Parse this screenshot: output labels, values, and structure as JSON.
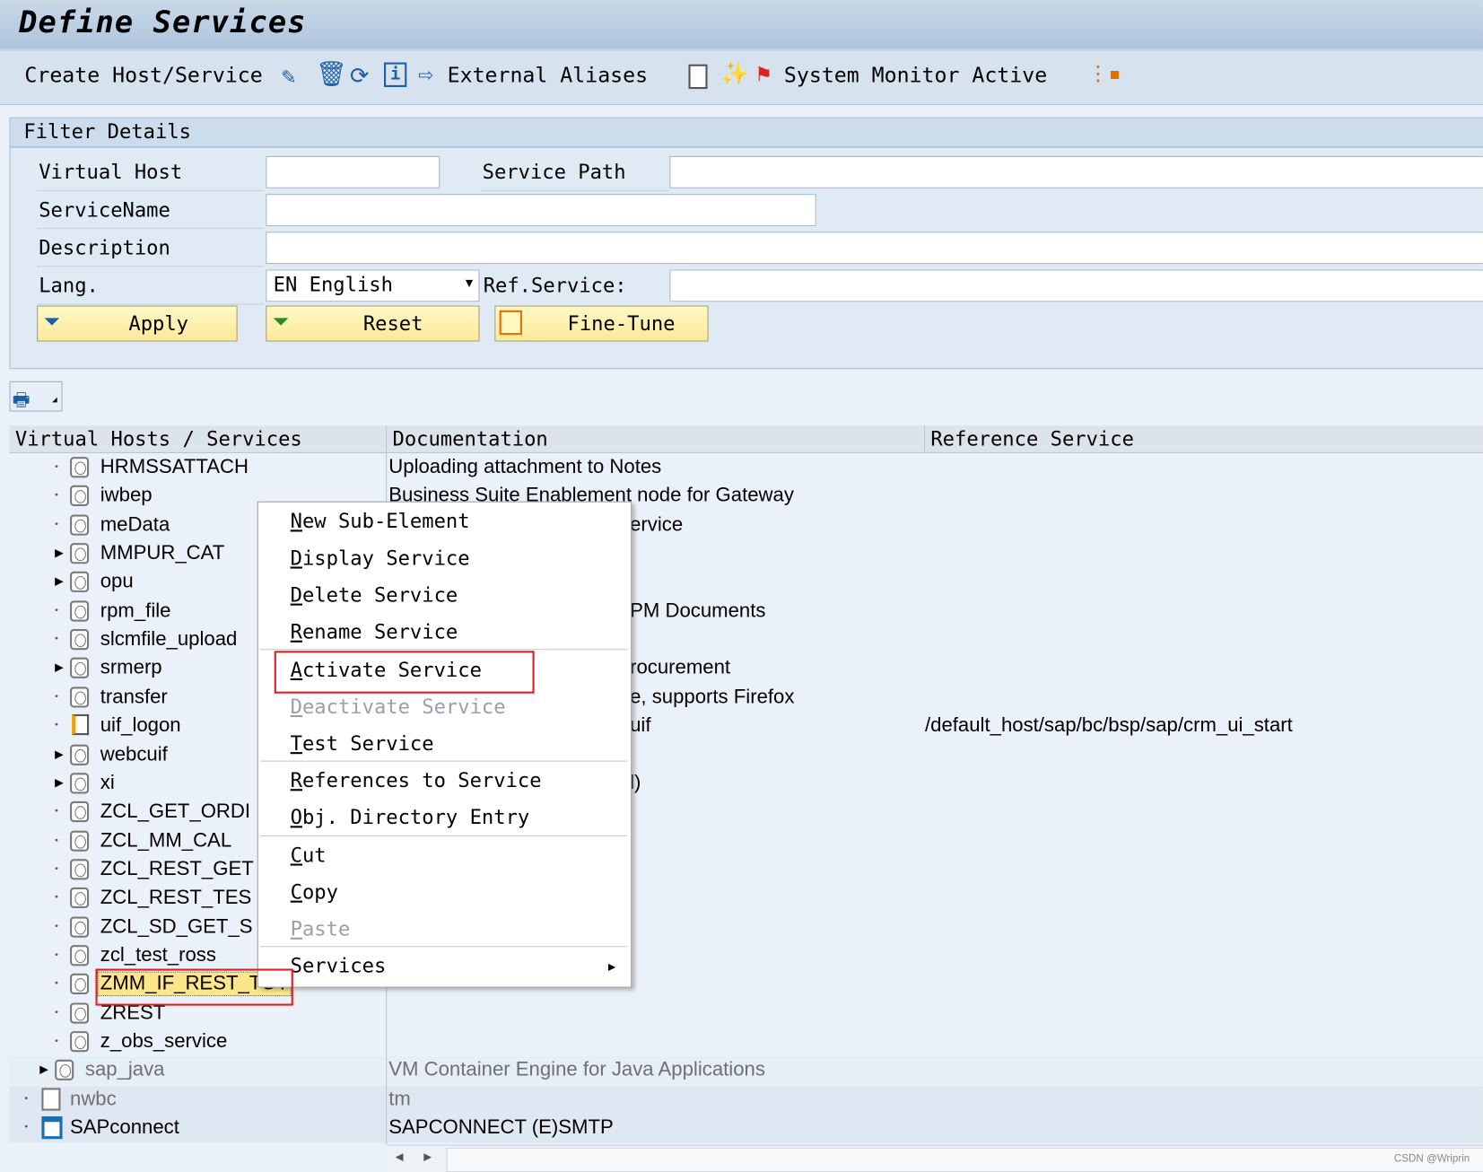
{
  "title": "Define Services",
  "toolbar": {
    "create": "Create Host/Service",
    "external_aliases": "External Aliases",
    "system_monitor": "System Monitor Active"
  },
  "filter": {
    "header": "Filter Details",
    "virtual_host_label": "Virtual Host",
    "virtual_host_value": "",
    "service_path_label": "Service Path",
    "service_path_value": "",
    "service_name_label": "ServiceName",
    "service_name_value": "",
    "description_label": "Description",
    "description_value": "",
    "lang_label": "Lang.",
    "lang_value": "EN English",
    "ref_service_label": "Ref.Service:",
    "ref_service_value": "",
    "apply": "Apply",
    "reset": "Reset",
    "fine_tune": "Fine-Tune"
  },
  "table": {
    "headers": [
      "Virtual Hosts / Services",
      "Documentation",
      "Reference Service"
    ],
    "rows": [
      {
        "name": "HRMSSATTACH",
        "exp": "dot",
        "level": 2,
        "doc": "Uploading attachment to Notes",
        "doc_at": "start",
        "ref": ""
      },
      {
        "name": "iwbep",
        "exp": "dot",
        "level": 2,
        "doc": "Business Suite Enablement node for Gateway",
        "doc_at": "start",
        "ref": ""
      },
      {
        "name": "meData",
        "exp": "dot",
        "level": 2,
        "doc": "ervice",
        "doc_at": "menu",
        "ref": ""
      },
      {
        "name": "MMPUR_CAT",
        "exp": "tri",
        "level": 2,
        "doc": "",
        "doc_at": "start",
        "ref": ""
      },
      {
        "name": "opu",
        "exp": "tri",
        "level": 2,
        "doc": "",
        "doc_at": "start",
        "ref": ""
      },
      {
        "name": "rpm_file",
        "exp": "dot",
        "level": 2,
        "doc": "PM Documents",
        "doc_at": "menu",
        "ref": ""
      },
      {
        "name": "slcmfile_upload",
        "exp": "dot",
        "level": 2,
        "doc": "",
        "doc_at": "start",
        "ref": ""
      },
      {
        "name": "srmerp",
        "exp": "tri",
        "level": 2,
        "doc": "rocurement",
        "doc_at": "menu",
        "ref": ""
      },
      {
        "name": "transfer",
        "exp": "dot",
        "level": 2,
        "doc": "e, supports Firefox",
        "doc_at": "menu",
        "ref": ""
      },
      {
        "name": "uif_logon",
        "exp": "dot",
        "level": 2,
        "icon": "alias",
        "doc": "uif",
        "doc_at": "menu",
        "ref": "/default_host/sap/bc/bsp/sap/crm_ui_start"
      },
      {
        "name": "webcuif",
        "exp": "tri",
        "level": 2,
        "doc": "",
        "doc_at": "start",
        "ref": ""
      },
      {
        "name": "xi",
        "exp": "tri",
        "level": 2,
        "doc": "l)",
        "doc_at": "menu",
        "ref": ""
      },
      {
        "name": "ZCL_GET_ORDI",
        "exp": "dot",
        "level": 2,
        "doc": "",
        "doc_at": "start",
        "ref": ""
      },
      {
        "name": "ZCL_MM_CAL",
        "exp": "dot",
        "level": 2,
        "doc": "",
        "doc_at": "start",
        "ref": ""
      },
      {
        "name": "ZCL_REST_GET",
        "exp": "dot",
        "level": 2,
        "doc": "",
        "doc_at": "start",
        "ref": ""
      },
      {
        "name": "ZCL_REST_TES",
        "exp": "dot",
        "level": 2,
        "doc": "",
        "doc_at": "start",
        "ref": ""
      },
      {
        "name": "ZCL_SD_GET_S",
        "exp": "dot",
        "level": 2,
        "doc": "",
        "doc_at": "start",
        "ref": ""
      },
      {
        "name": "zcl_test_ross",
        "exp": "dot",
        "level": 2,
        "doc": "",
        "doc_at": "start",
        "ref": ""
      },
      {
        "name": "ZMM_IF_REST_TOT",
        "exp": "dot",
        "level": 2,
        "selected": true,
        "doc": "",
        "doc_at": "start",
        "ref": ""
      },
      {
        "name": "ZREST",
        "exp": "dot",
        "level": 2,
        "doc": "",
        "doc_at": "start",
        "ref": ""
      },
      {
        "name": "z_obs_service",
        "exp": "dot",
        "level": 2,
        "doc": "",
        "doc_at": "start",
        "ref": ""
      },
      {
        "name": "sap_java",
        "exp": "tri",
        "level": 1,
        "grey": true,
        "band": true,
        "doc": "VM Container Engine for Java Applications",
        "doc_at": "start",
        "ref": ""
      },
      {
        "name": "nwbc",
        "exp": "dot",
        "level": 0,
        "grey": true,
        "icon": "doc",
        "band": true,
        "doc": "tm",
        "doc_at": "start",
        "ref": ""
      },
      {
        "name": "SAPconnect",
        "exp": "dot",
        "level": 0,
        "icon": "connect",
        "band": true,
        "doc": "SAPCONNECT (E)SMTP",
        "doc_at": "start",
        "ref": ""
      }
    ]
  },
  "context_menu": {
    "items": [
      {
        "m": "N",
        "rest": "ew Sub-Element",
        "disabled": false
      },
      {
        "m": "D",
        "rest": "isplay Service",
        "disabled": false
      },
      {
        "m": "D",
        "rest": "elete Service",
        "disabled": false
      },
      {
        "m": "R",
        "rest": "ename Service",
        "disabled": false
      },
      {
        "m": "A",
        "rest": "ctivate Service",
        "disabled": false,
        "highlighted": true
      },
      {
        "m": "D",
        "rest": "eactivate Service",
        "disabled": true
      },
      {
        "m": "T",
        "rest": "est Service",
        "disabled": false
      },
      {
        "m": "R",
        "rest": "eferences to Service",
        "disabled": false
      },
      {
        "m": "O",
        "rest": "bj. Directory Entry",
        "disabled": false
      },
      {
        "m": "C",
        "rest": "ut",
        "disabled": false
      },
      {
        "m": "C",
        "rest": "opy",
        "disabled": false
      },
      {
        "m": "P",
        "rest": "aste",
        "disabled": true
      },
      {
        "m": "",
        "rest": "Services",
        "disabled": false,
        "submenu": true
      }
    ]
  },
  "watermark": "CSDN @Wriprin",
  "colors": {
    "highlight_box": "#e02020",
    "selected_row": "#fde68a",
    "button_bg": "#fde99a",
    "title_bg": "#aec4dc"
  }
}
